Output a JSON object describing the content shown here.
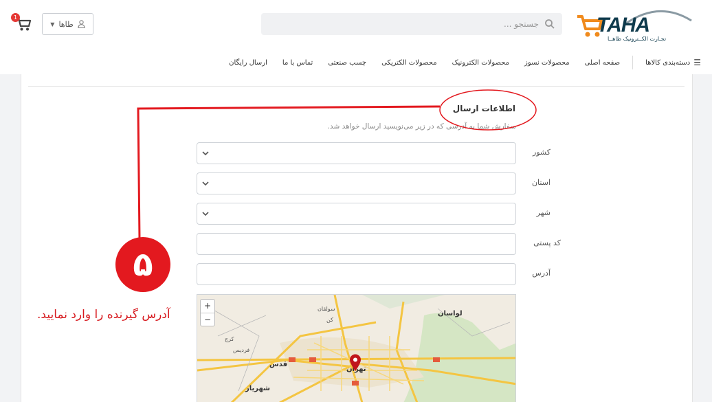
{
  "header": {
    "logo_text": "TAHA",
    "logo_tagline": "تجـارت الکــترونیک طاهــا",
    "search_placeholder": "جستجو ...",
    "user_label": "طاها",
    "cart_count": "1"
  },
  "nav": {
    "categories_label": "دسته‌بندی کالاها",
    "items": [
      "صفحه اصلی",
      "محصولات نسوز",
      "محصولات الکترونیک",
      "محصولات الکتریکی",
      "چسب صنعتی",
      "تماس با ما",
      "ارسال رایگان"
    ]
  },
  "form": {
    "title": "اطلاعات ارسال",
    "description": "سفارش شما به آدرسی که در زیر می‌نویسید ارسال خواهد شد.",
    "fields": {
      "country": "کشور",
      "province": "استان",
      "city": "شهر",
      "postal_code": "کد پستی",
      "address": "آدرس"
    }
  },
  "map": {
    "zoom_in": "+",
    "zoom_out": "−",
    "labels": [
      "لواسان",
      "تهران",
      "قدس",
      "شهریار",
      "سولقان",
      "کن",
      "فردیس",
      "کرج"
    ]
  },
  "annotation": {
    "step_number": "۵",
    "step_text": "آدرس گیرنده را وارد نمایید."
  },
  "colors": {
    "annotation_red": "#e3191f",
    "logo_orange": "#f08a1c",
    "logo_navy": "#0e3a4c"
  }
}
